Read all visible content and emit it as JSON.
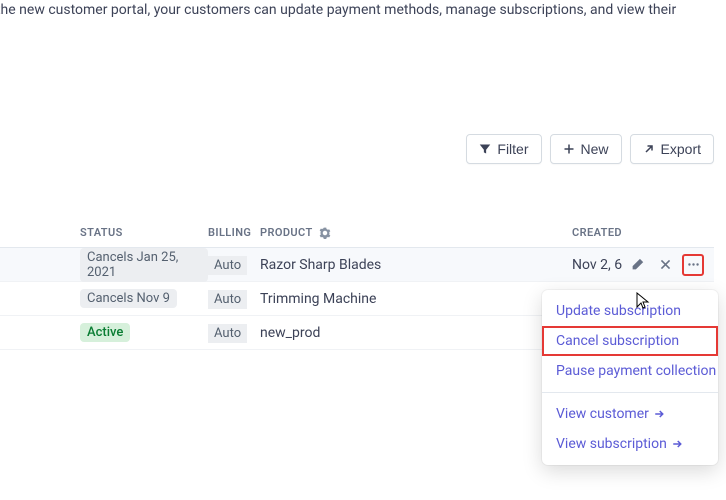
{
  "banner": {
    "text": "s. With the new customer portal, your customers can update payment methods, manage subscriptions, and view their"
  },
  "toolbar": {
    "filter_label": "Filter",
    "new_label": "New",
    "export_label": "Export"
  },
  "table": {
    "headers": {
      "status": "STATUS",
      "billing": "BILLING",
      "product": "PRODUCT",
      "created": "CREATED"
    },
    "rows": [
      {
        "status": "Cancels Jan 25, 2021",
        "status_kind": "cancel",
        "billing": "Auto",
        "product": "Razor Sharp Blades",
        "created": "Nov 2, 6",
        "hovered": true
      },
      {
        "status": "Cancels Nov 9",
        "status_kind": "cancel",
        "billing": "Auto",
        "product": "Trimming Machine",
        "created": "",
        "hovered": false
      },
      {
        "status": "Active",
        "status_kind": "active",
        "billing": "Auto",
        "product": "new_prod",
        "created": "",
        "hovered": false
      }
    ]
  },
  "popover": {
    "update_label": "Update subscription",
    "cancel_label": "Cancel subscription",
    "pause_label": "Pause payment collection",
    "view_customer_label": "View customer",
    "view_subscription_label": "View subscription"
  }
}
